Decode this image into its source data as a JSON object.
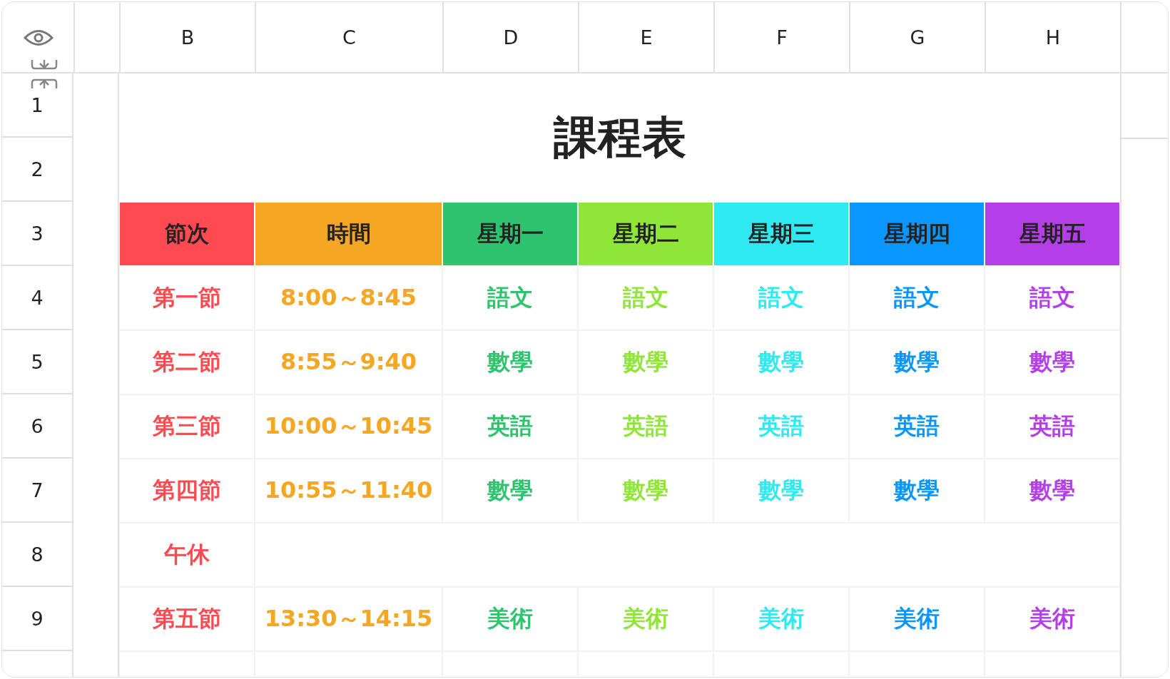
{
  "column_headers": [
    "B",
    "C",
    "D",
    "E",
    "F",
    "G",
    "H"
  ],
  "row_numbers": [
    "1",
    "2",
    "3",
    "4",
    "5",
    "6",
    "7",
    "8",
    "9"
  ],
  "title": "課程表",
  "table_header": [
    {
      "label": "節次",
      "color": "#ff4a52"
    },
    {
      "label": "時間",
      "color": "#f5a623"
    },
    {
      "label": "星期一",
      "color": "#2ec46e"
    },
    {
      "label": "星期二",
      "color": "#8fe636"
    },
    {
      "label": "星期三",
      "color": "#2eeaf0"
    },
    {
      "label": "星期四",
      "color": "#0a96ff"
    },
    {
      "label": "星期五",
      "color": "#b43ee8"
    }
  ],
  "periods": [
    {
      "kind": "class",
      "period": "第一節",
      "time": "8:00～8:45",
      "subjects": [
        "語文",
        "語文",
        "語文",
        "語文",
        "語文"
      ]
    },
    {
      "kind": "class",
      "period": "第二節",
      "time": "8:55～9:40",
      "subjects": [
        "數學",
        "數學",
        "數學",
        "數學",
        "數學"
      ]
    },
    {
      "kind": "class",
      "period": "第三節",
      "time": "10:00～10:45",
      "subjects": [
        "英語",
        "英語",
        "英語",
        "英語",
        "英語"
      ]
    },
    {
      "kind": "class",
      "period": "第四節",
      "time": "10:55～11:40",
      "subjects": [
        "數學",
        "數學",
        "數學",
        "數學",
        "數學"
      ]
    },
    {
      "kind": "break",
      "period": "午休"
    },
    {
      "kind": "class",
      "period": "第五節",
      "time": "13:30～14:15",
      "subjects": [
        "美術",
        "美術",
        "美術",
        "美術",
        "美術"
      ]
    }
  ]
}
